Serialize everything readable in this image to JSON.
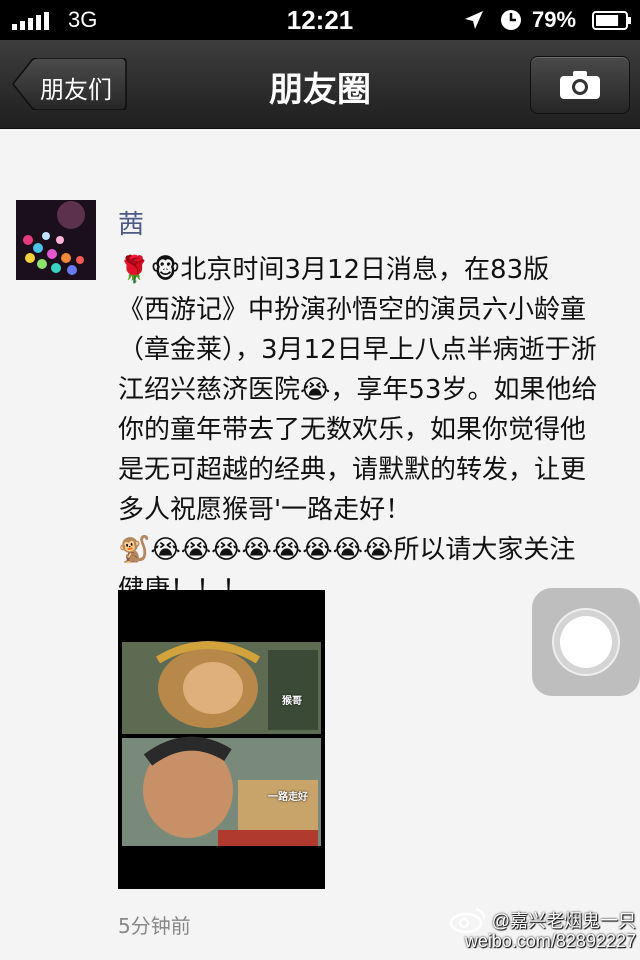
{
  "status_bar": {
    "carrier": "3G",
    "time": "12:21",
    "battery": "79%",
    "battery_level": 0.79,
    "icons": [
      "signal-icon",
      "location-icon",
      "clock-icon",
      "battery-icon"
    ]
  },
  "navbar": {
    "back_label": "朋友们",
    "title": "朋友圈",
    "camera_icon": "camera-icon"
  },
  "post": {
    "author": "茜",
    "text": "🌹🐵北京时间3月12日消息，在83版《西游记》中扮演孙悟空的演员六小龄童（章金莱），3月12日早上八点半病逝于浙江绍兴慈济医院😭，享年53岁。如果他给你的童年带去了无数欢乐，如果你觉得他是无可超越的经典，请默默的转发，让更多人祝愿猴哥'一路走好！\n🐒😭😭😭😭😭😭😭😭所以请大家关注健康！！！",
    "image": {
      "caption_top": "猴哥",
      "caption_bottom": "一路走好"
    },
    "timestamp": "5分钟前"
  },
  "watermark": {
    "line1": "@嘉兴老烟鬼一只",
    "line2": "weibo.com/82892227"
  },
  "colors": {
    "author": "#4c5a85",
    "navbar": "#2b2b2b",
    "background": "#f4f4f4"
  }
}
